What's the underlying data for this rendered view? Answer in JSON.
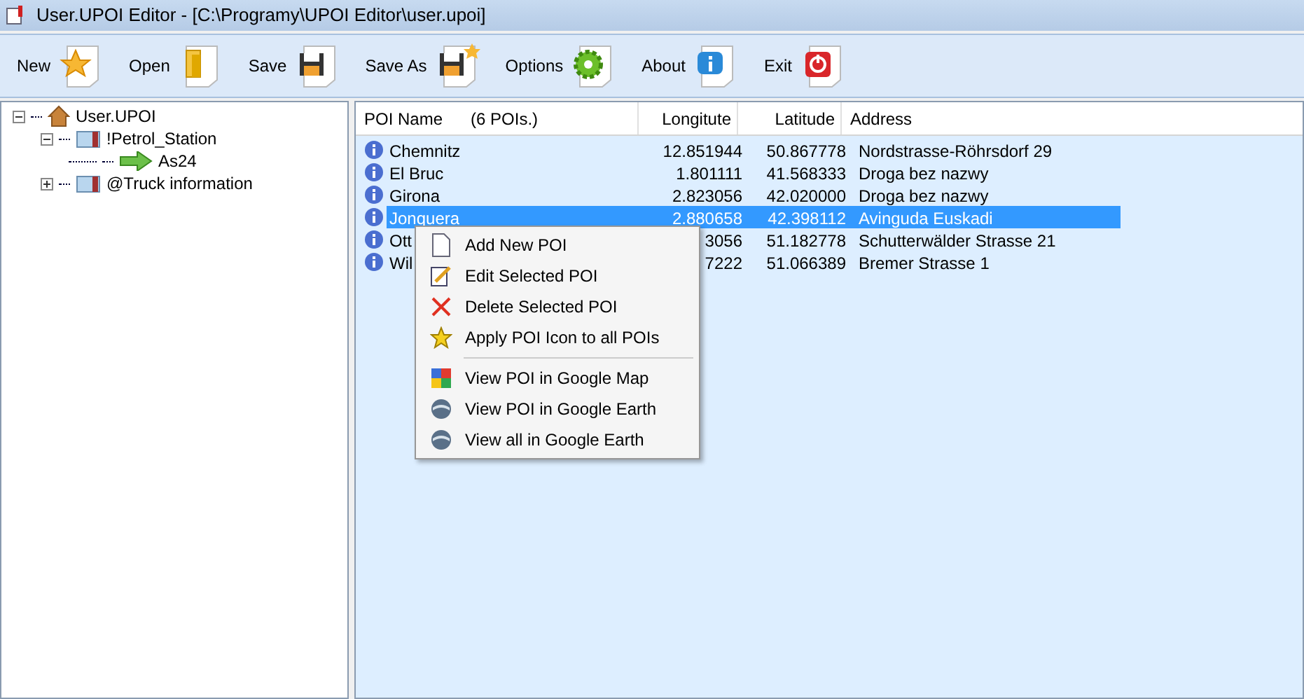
{
  "window": {
    "title": "User.UPOI Editor - [C:\\Programy\\UPOI Editor\\user.upoi]"
  },
  "toolbar": [
    {
      "kind": "new",
      "label": "New"
    },
    {
      "kind": "open",
      "label": "Open"
    },
    {
      "kind": "save",
      "label": "Save"
    },
    {
      "kind": "saveas",
      "label": "Save As"
    },
    {
      "kind": "options",
      "label": "Options"
    },
    {
      "kind": "about",
      "label": "About"
    },
    {
      "kind": "exit",
      "label": "Exit"
    }
  ],
  "tree": [
    {
      "kind": "root",
      "label": "User.UPOI",
      "expanded": true,
      "children": [
        {
          "kind": "folder",
          "label": "!Petrol_Station",
          "expanded": true,
          "children": [
            {
              "kind": "poi",
              "label": "As24"
            }
          ]
        },
        {
          "kind": "folder",
          "label": "@Truck information",
          "expanded": false
        }
      ]
    }
  ],
  "table": {
    "columns": [
      "POI Name",
      "Longitute",
      "Latitude",
      "Address"
    ],
    "count": "(6 POIs.)",
    "rows": [
      {
        "name": "Chemnitz",
        "longitude": "12.851944",
        "latitude": "50.867778",
        "address": "Nordstrasse-Röhrsdorf 29",
        "selected": false
      },
      {
        "name": "El Bruc",
        "longitude": "1.801111",
        "latitude": "41.568333",
        "address": "Droga bez nazwy",
        "selected": false
      },
      {
        "name": "Girona",
        "longitude": "2.823056",
        "latitude": "42.020000",
        "address": "Droga bez nazwy",
        "selected": false
      },
      {
        "name": "Jonquera",
        "longitude": "2.880658",
        "latitude": "42.398112",
        "address": "Avinguda Euskadi",
        "selected": true
      },
      {
        "name": "Ott",
        "longitude": "3056",
        "latitude": "51.182778",
        "address": "Schutterwälder Strasse 21",
        "selected": false
      },
      {
        "name": "Wil",
        "longitude": "7222",
        "latitude": "51.066389",
        "address": "Bremer Strasse 1",
        "selected": false
      }
    ]
  },
  "context_menu": [
    {
      "kind": "page",
      "label": "Add New POI"
    },
    {
      "kind": "edit",
      "label": "Edit Selected POI"
    },
    {
      "kind": "delete",
      "label": "Delete Selected POI"
    },
    {
      "kind": "star",
      "label": "Apply POI Icon to all POIs"
    },
    {
      "kind": "map",
      "label": "View POI in Google Map",
      "separator_before": true
    },
    {
      "kind": "globe",
      "label": "View POI in Google Earth"
    },
    {
      "kind": "globe",
      "label": "View all in Google Earth"
    }
  ]
}
